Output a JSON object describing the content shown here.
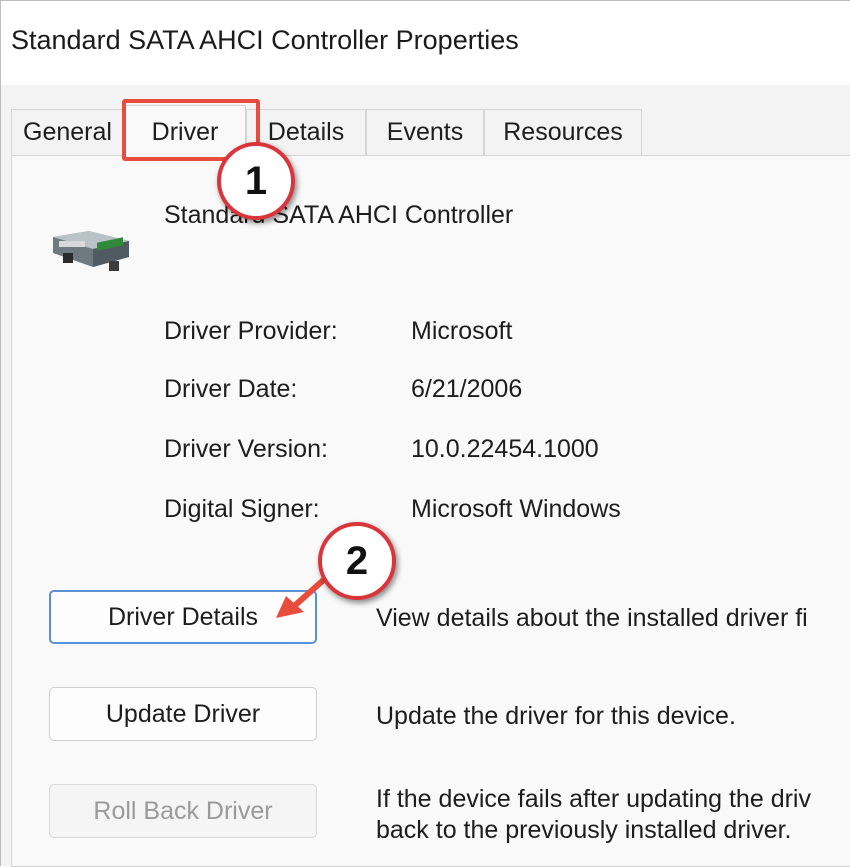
{
  "window": {
    "title": "Standard SATA AHCI Controller Properties"
  },
  "tabs": [
    {
      "label": "General"
    },
    {
      "label": "Driver",
      "active": true
    },
    {
      "label": "Details"
    },
    {
      "label": "Events"
    },
    {
      "label": "Resources"
    }
  ],
  "device": {
    "name": "Standard SATA AHCI Controller",
    "icon": "storage-controller-icon"
  },
  "driver_info": [
    {
      "label": "Driver Provider:",
      "value": "Microsoft"
    },
    {
      "label": "Driver Date:",
      "value": "6/21/2006"
    },
    {
      "label": "Driver Version:",
      "value": "10.0.22454.1000"
    },
    {
      "label": "Digital Signer:",
      "value": "Microsoft Windows"
    }
  ],
  "actions": [
    {
      "label": "Driver Details",
      "description": "View details about the installed driver fi",
      "state": "focused"
    },
    {
      "label": "Update Driver",
      "description": "Update the driver for this device.",
      "state": "enabled"
    },
    {
      "label": "Roll Back Driver",
      "description_lines": [
        "If the device fails after updating the driv",
        "back to the previously installed driver."
      ],
      "state": "disabled"
    }
  ],
  "annotations": {
    "step1": "1",
    "step2": "2",
    "highlight_color": "#e74c3c",
    "callout_border_color": "#d9353a"
  },
  "colors": {
    "focus_border": "#5b8fd6",
    "disabled_text": "#9a9a9a"
  }
}
